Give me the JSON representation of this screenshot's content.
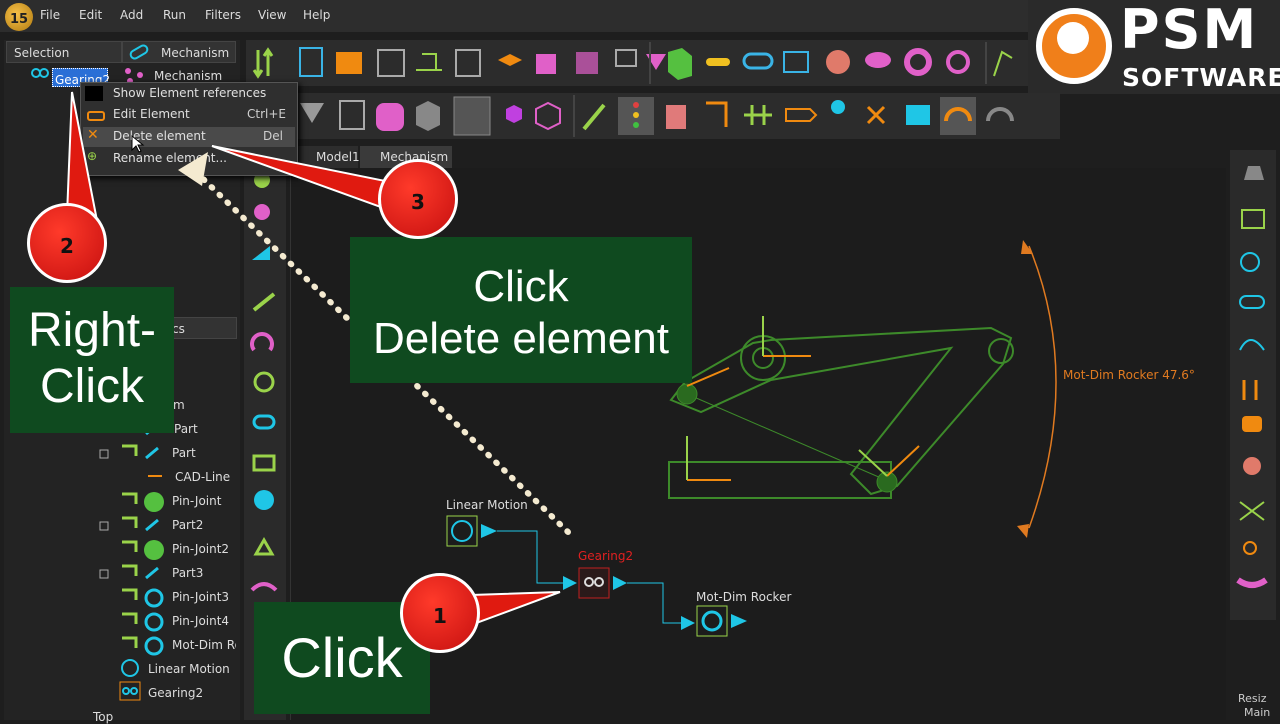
{
  "app": {
    "logo_text": "15"
  },
  "menu": [
    "File",
    "Edit",
    "Add",
    "Run",
    "Filters",
    "View",
    "Help"
  ],
  "brand": {
    "name": "PSM",
    "sub": "SOFTWARE",
    "accent": "#f07f1a"
  },
  "tabs": {
    "selection": "Selection",
    "mechanism": "Mechanism",
    "lower_tab_partial": "cs"
  },
  "tree_top": {
    "selected": "Gearing2",
    "mechanism": "Mechanism"
  },
  "context_menu": {
    "items": [
      {
        "label": "Show Element references",
        "shortcut": ""
      },
      {
        "label": "Edit Element",
        "shortcut": "Ctrl+E"
      },
      {
        "label": "Delete element",
        "shortcut": "Del"
      },
      {
        "label": "Rename element...",
        "shortcut": ""
      }
    ]
  },
  "tree_items": [
    {
      "label": "m"
    },
    {
      "label": "Part"
    },
    {
      "label": "Part"
    },
    {
      "label": "CAD-Line"
    },
    {
      "label": "Pin-Joint"
    },
    {
      "label": "Part2"
    },
    {
      "label": "Pin-Joint2"
    },
    {
      "label": "Part3"
    },
    {
      "label": "Pin-Joint3"
    },
    {
      "label": "Pin-Joint4"
    },
    {
      "label": "Mot-Dim Ro"
    },
    {
      "label": "Linear Motion"
    },
    {
      "label": "Gearing2"
    },
    {
      "label": "Top"
    }
  ],
  "doc_tabs": {
    "model": "Model1",
    "mechanism": "Mechanism",
    "partial": "B"
  },
  "viewport": {
    "nodes": {
      "linear_motion": "Linear Motion",
      "gearing": "Gearing2",
      "rocker": "Mot-Dim Rocker"
    },
    "dimension_label": "Mot-Dim Rocker 47.6°"
  },
  "callouts": {
    "step1": {
      "badge": "1",
      "text": "Click"
    },
    "step2": {
      "badge": "2",
      "text_line1": "Right-",
      "text_line2": "Click"
    },
    "step3": {
      "badge": "3",
      "text_line1": "Click",
      "text_line2": "Delete element"
    }
  },
  "status": {
    "line1": "Resiz",
    "line2": "Main"
  },
  "colors": {
    "selection_blue": "#2a6fd6",
    "node_cyan": "#1fc6e6",
    "mech_green": "#3d8a2a",
    "dim_orange": "#e07a20",
    "callout_green": "#0f4a1f",
    "badge_red": "#e01a10"
  }
}
